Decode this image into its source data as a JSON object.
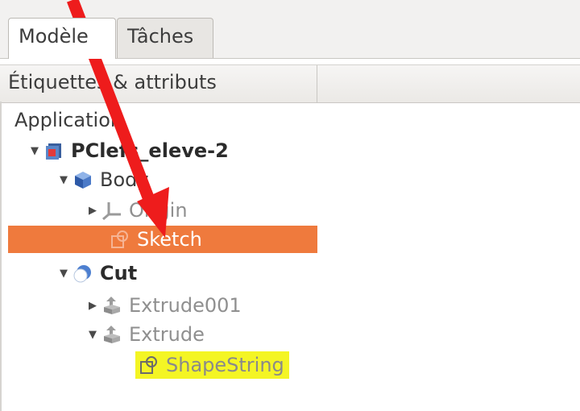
{
  "tabs": [
    {
      "label": "Modèle",
      "active": true
    },
    {
      "label": "Tâches",
      "active": false
    }
  ],
  "header": {
    "column_label": "Étiquettes & attributs"
  },
  "tree": {
    "root_label": "Application",
    "document": {
      "label": "PClefs_eleve-2",
      "icon": "document-icon"
    },
    "body": {
      "label": "Body",
      "icon": "body-icon"
    },
    "origin": {
      "label": "Origin",
      "icon": "origin-icon"
    },
    "sketch": {
      "label": "Sketch",
      "icon": "sketch-icon",
      "selected": true
    },
    "cut": {
      "label": "Cut",
      "icon": "cut-icon"
    },
    "extrude001": {
      "label": "Extrude001",
      "icon": "extrude-icon"
    },
    "extrude": {
      "label": "Extrude",
      "icon": "extrude-icon"
    },
    "shapestring": {
      "label": "ShapeString",
      "icon": "shapestring-icon",
      "highlighted": true
    }
  },
  "colors": {
    "selection": "#ef7a3d",
    "highlight": "#f4f524",
    "annotation_arrow": "#ee1c1c"
  }
}
